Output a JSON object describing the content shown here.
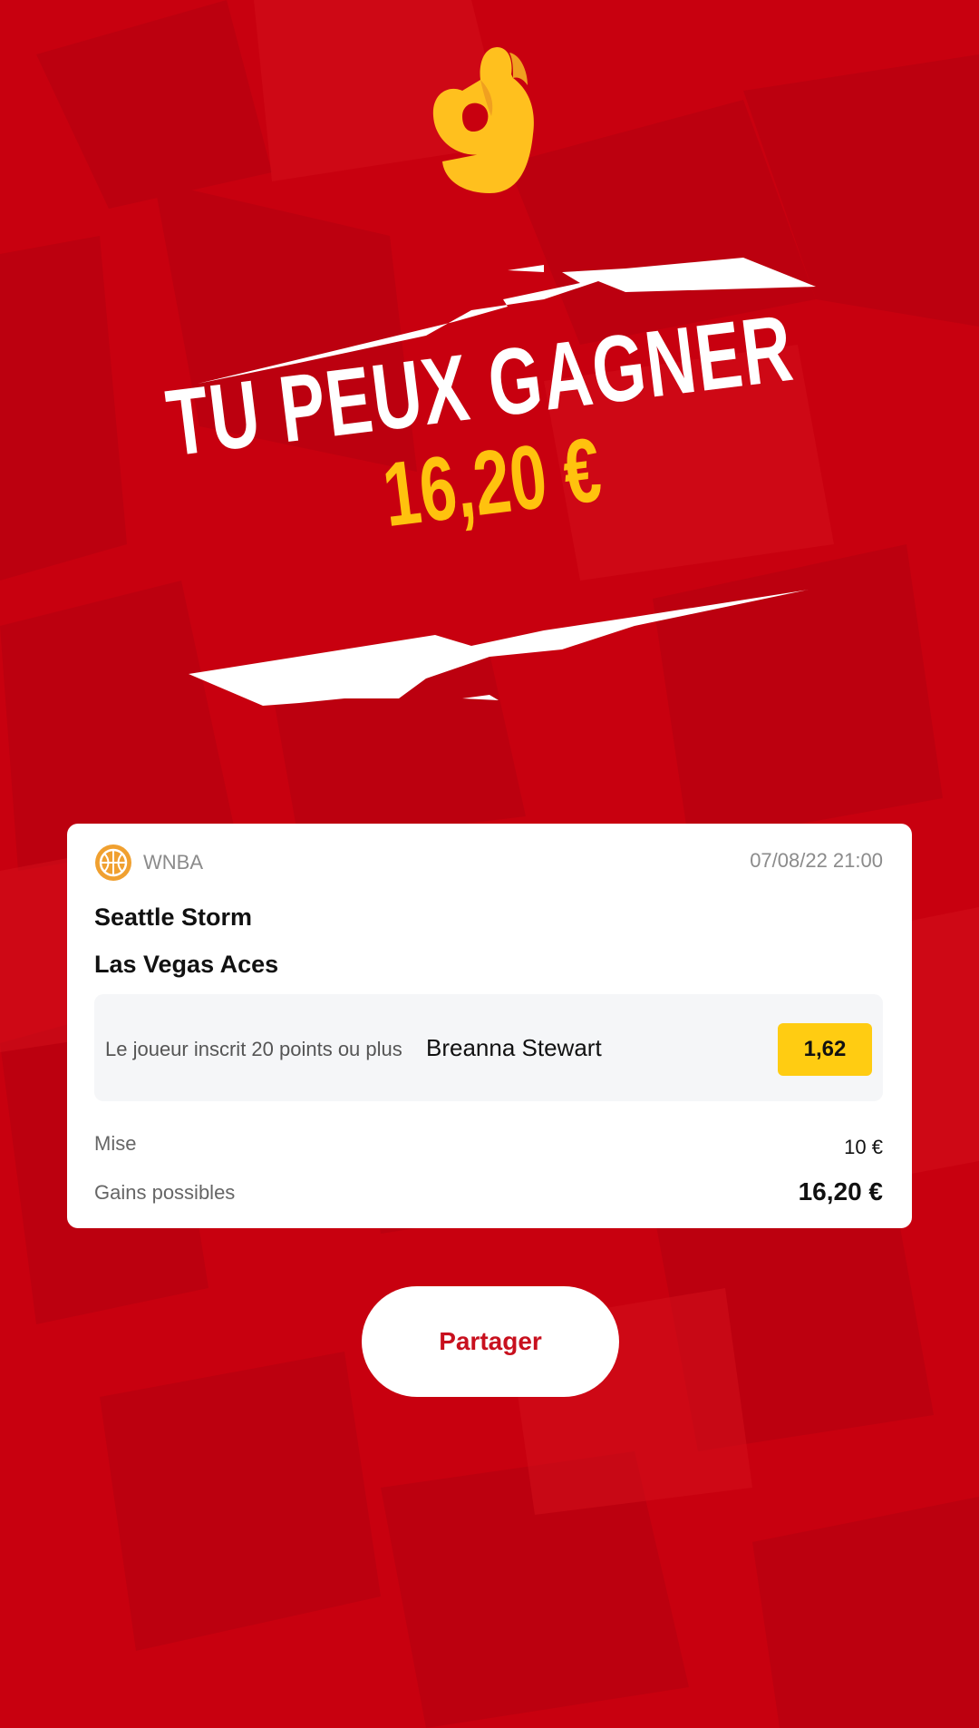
{
  "theme": {
    "background": "#c8000f",
    "accent": "#ffc20e",
    "odds_badge": "#ffcc12",
    "share_text": "#c8101e"
  },
  "hero": {
    "emoji_icon": "ok-hand-icon",
    "title": "TU PEUX GAGNER",
    "amount": "16,20 €"
  },
  "bet": {
    "league": "WNBA",
    "league_icon": "basketball-icon",
    "datetime": "07/08/22 21:00",
    "home_team": "Seattle Storm",
    "away_team": "Las Vegas Aces",
    "market": "Le joueur inscrit 20 points ou plus",
    "selection": "Breanna Stewart",
    "odds": "1,62",
    "stake_label": "Mise",
    "stake_value": "10 €",
    "gain_label": "Gains possibles",
    "gain_value": "16,20 €"
  },
  "actions": {
    "share_label": "Partager"
  }
}
